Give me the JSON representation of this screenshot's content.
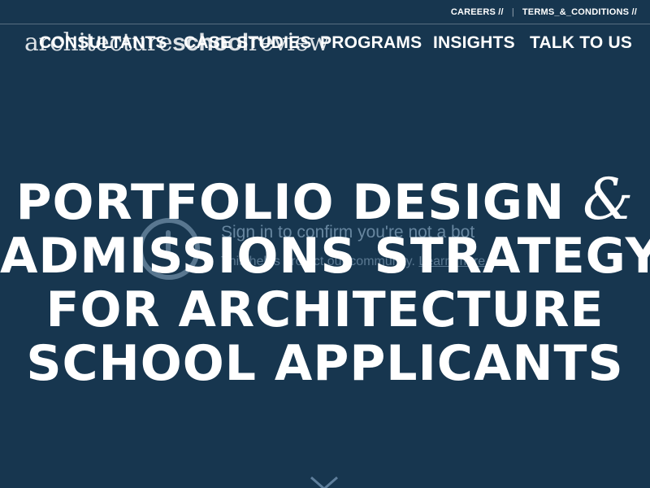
{
  "util": {
    "links": [
      "CAREERS",
      "TERMS_&_CONDITIONS"
    ],
    "suffix": "//"
  },
  "brand": {
    "part1": "architecture",
    "part2": "school",
    "part3": "review"
  },
  "nav": {
    "items": [
      "CONSULTANTS",
      "CASE STUDIES",
      "PROGRAMS",
      "INSIGHTS",
      "TALK TO US"
    ]
  },
  "overlay": {
    "title": "Sign in to confirm you're not a bot",
    "subtitle": "This helps protect our community.",
    "link": "Learn more"
  },
  "hero": {
    "line1": "PORTFOLIO DESIGN",
    "amp": "&",
    "line2": "ADMISSIONS STRATEGY",
    "line3": "FOR ARCHITECTURE",
    "line4": "SCHOOL APPLICANTS"
  },
  "colors": {
    "background": "#17364f",
    "text": "#ffffff"
  },
  "icons": {
    "scroll": "chevron-down-icon",
    "bot_check": "clock-icon"
  }
}
